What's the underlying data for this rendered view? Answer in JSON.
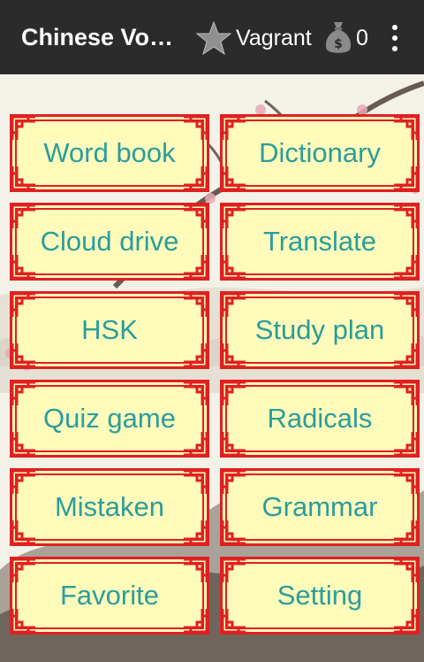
{
  "app": {
    "title": "Chinese Vo…",
    "user_name": "Vagrant",
    "coins": "0"
  },
  "icons": {
    "star": "star-icon",
    "bag": "money-bag-icon",
    "menu": "overflow-menu-icon"
  },
  "colors": {
    "appbar": "#2b2b2b",
    "tile_bg": "#fffbbb",
    "tile_border": "#e02020",
    "tile_text": "#2a9d9d"
  },
  "menu": {
    "items": [
      {
        "label": "Word book"
      },
      {
        "label": "Dictionary"
      },
      {
        "label": "Cloud drive"
      },
      {
        "label": "Translate"
      },
      {
        "label": "HSK"
      },
      {
        "label": "Study plan"
      },
      {
        "label": "Quiz game"
      },
      {
        "label": "Radicals"
      },
      {
        "label": "Mistaken"
      },
      {
        "label": "Grammar"
      },
      {
        "label": "Favorite"
      },
      {
        "label": "Setting"
      }
    ]
  }
}
